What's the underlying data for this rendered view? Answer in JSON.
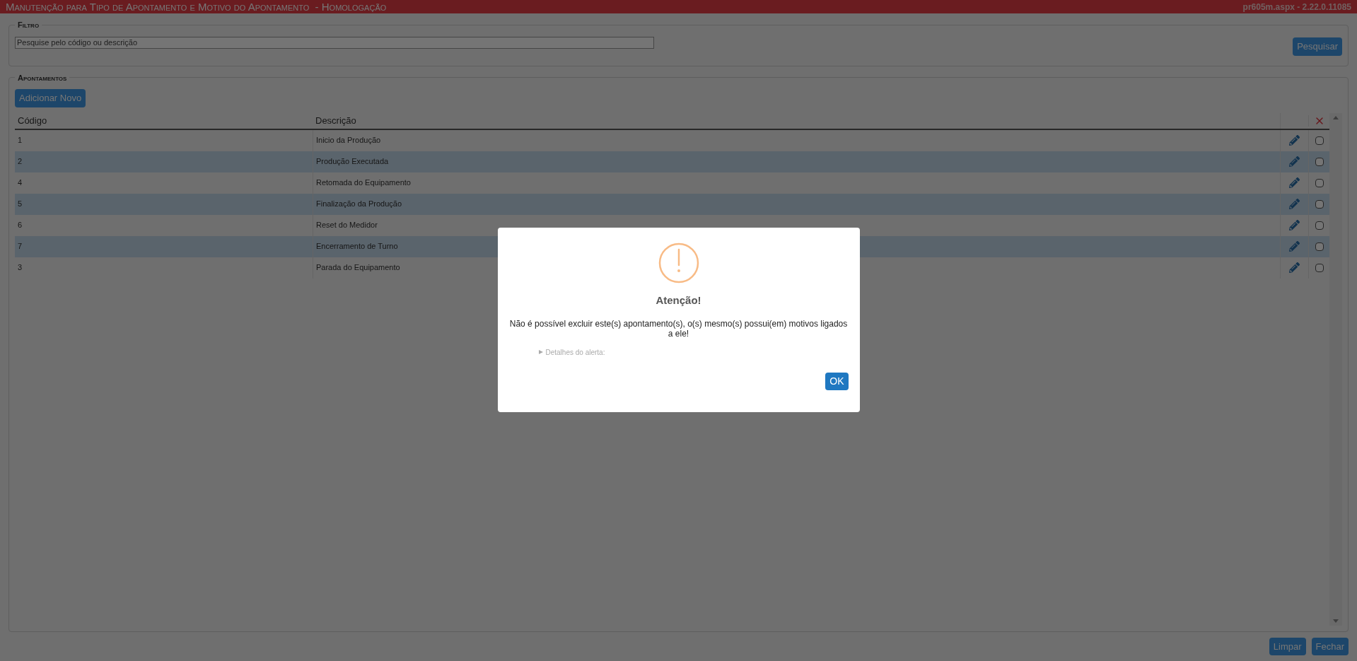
{
  "header": {
    "title": "Manutenção para Tipo de Apontamento e Motivo do Apontamento  - Homologação",
    "version": "pr605m.aspx - 2.22.0.11085"
  },
  "filter": {
    "legend": "Filtro",
    "search": {
      "placeholder": "Pesquise pelo código ou descrição"
    },
    "search_button": "Pesquisar"
  },
  "appointments": {
    "legend": "Apontamentos",
    "add_button": "Adicionar Novo",
    "table": {
      "columns": [
        "Código",
        "Descrição"
      ],
      "rows": [
        {
          "code": "1",
          "description": "Inicio da Produção",
          "checked": false
        },
        {
          "code": "2",
          "description": "Produção Executada",
          "checked": false
        },
        {
          "code": "4",
          "description": "Retomada do Equipamento",
          "checked": false
        },
        {
          "code": "5",
          "description": "Finalização da Produção",
          "checked": false
        },
        {
          "code": "6",
          "description": "Reset do Medidor",
          "checked": false
        },
        {
          "code": "7",
          "description": "Encerramento de Turno",
          "checked": false
        },
        {
          "code": "3",
          "description": "Parada do Equipamento",
          "checked": false
        }
      ]
    }
  },
  "footer_buttons": [
    "Limpar",
    "Fechar"
  ],
  "dialog": {
    "title": "Atenção!",
    "message": "Não é possível excluir este(s) apontamento(s), o(s) mesmo(s) possui(em) motivos ligados a ele!",
    "details": {
      "label": "Detalhes do alerta:",
      "expanded": false
    },
    "button": "OK"
  }
}
